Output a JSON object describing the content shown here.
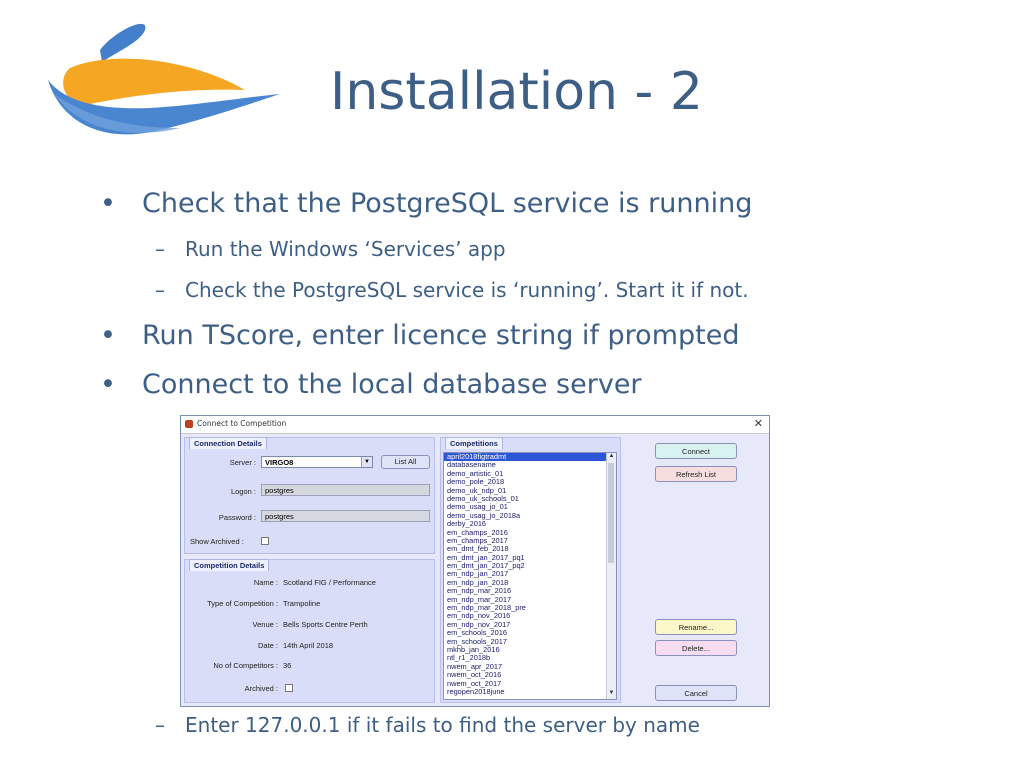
{
  "slide": {
    "title": "Installation - 2",
    "bullets": [
      "Check that the PostgreSQL service is running",
      "Run TScore, enter licence string if prompted",
      "Connect to the local database server"
    ],
    "sub_bullets": [
      "Run the Windows ‘Services’ app",
      "Check the PostgreSQL service is ‘running’. Start it if not.",
      "Enter 127.0.0.1 if it fails to find the server by name"
    ],
    "bullet_glyph": "•",
    "dash_glyph": "–"
  },
  "dialog": {
    "title": "Connect to Competition",
    "close_glyph": "✕",
    "connection": {
      "header": "Connection Details",
      "server_label": "Server :",
      "server_value": "VIRGO8",
      "list_all_label": "List All",
      "logon_label": "Logon :",
      "logon_value": "postgres",
      "password_label": "Password :",
      "password_value": "postgres",
      "show_archived_label": "Show Archived :"
    },
    "competition": {
      "header": "Competition Details",
      "name_label": "Name :",
      "name_value": "Scotland FIG / Performance",
      "type_label": "Type of Competition :",
      "type_value": "Trampoline",
      "venue_label": "Venue :",
      "venue_value": "Bells Sports Centre Perth",
      "date_label": "Date :",
      "date_value": "14th April 2018",
      "competitors_label": "No of Competitors :",
      "competitors_value": "36",
      "archived_label": "Archived :"
    },
    "competitions_header": "Competitions",
    "competitions": [
      "april2018figtradmt",
      "databasename",
      "demo_artistic_01",
      "demo_pole_2018",
      "demo_uk_ndp_01",
      "demo_uk_schools_01",
      "demo_usag_jo_01",
      "demo_usag_jo_2018a",
      "derby_2016",
      "em_champs_2016",
      "em_champs_2017",
      "em_dmt_feb_2018",
      "em_dmt_jan_2017_pq1",
      "em_dmt_jan_2017_pq2",
      "em_ndp_jan_2017",
      "em_ndp_jan_2018",
      "em_ndp_mar_2016",
      "em_ndp_mar_2017",
      "em_ndp_mar_2018_pre",
      "em_ndp_nov_2016",
      "em_ndp_nov_2017",
      "em_schools_2016",
      "em_schools_2017",
      "mkhb_jan_2016",
      "ntl_r1_2018b",
      "nwem_apr_2017",
      "nwem_oct_2016",
      "nwem_oct_2017",
      "regopen2018june"
    ],
    "buttons": {
      "connect": "Connect",
      "refresh": "Refresh List",
      "rename": "Rename...",
      "delete": "Delete...",
      "cancel": "Cancel"
    },
    "colors": {
      "connect": "#d8f2f2",
      "refresh": "#f7dede",
      "rename": "#fbf7c8",
      "delete": "#f6dcf0",
      "cancel": "#dfe3f7"
    }
  }
}
